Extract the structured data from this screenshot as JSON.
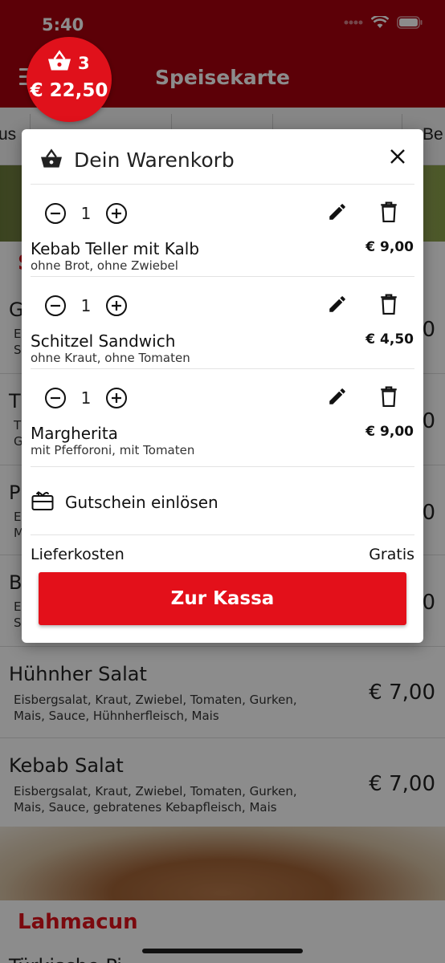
{
  "status_bar": {
    "time": "5:40"
  },
  "nav": {
    "title": "Speisekarte"
  },
  "categories": [
    "us",
    "Be"
  ],
  "cart_badge": {
    "count": "3",
    "total": "€ 22,50"
  },
  "menu": {
    "section_letter": "S",
    "items": [
      {
        "name": "G",
        "desc": "Ei\nS",
        "price": "0"
      },
      {
        "name": "T",
        "desc": "T\nG",
        "price": "0"
      },
      {
        "name": "P",
        "desc": "Ei\nM",
        "price": "0"
      },
      {
        "name": "B",
        "desc": "Ei\nS",
        "price": "0"
      },
      {
        "name": "Hühnher Salat",
        "desc": "Eisbergsalat, Kraut, Zwiebel, Tomaten, Gurken, Mais, Sauce, Hühnherfleisch, Mais",
        "price": "€ 7,00"
      },
      {
        "name": "Kebab Salat",
        "desc": "Eisbergsalat, Kraut, Zwiebel, Tomaten, Gurken, Mais, Sauce, gebratenes Kebapfleisch, Mais",
        "price": "€ 7,00"
      }
    ],
    "section2_title": "Lahmacun",
    "section2_next": "Türkische Pi"
  },
  "cart": {
    "title": "Dein Warenkorb",
    "items": [
      {
        "qty": "1",
        "name": "Kebab Teller mit Kalb",
        "options": "ohne Brot, ohne Zwiebel",
        "price": "€ 9,00"
      },
      {
        "qty": "1",
        "name": "Schitzel Sandwich",
        "options": "ohne Kraut, ohne Tomaten",
        "price": "€ 4,50"
      },
      {
        "qty": "1",
        "name": "Margherita",
        "options": "mit Pfefforoni, mit Tomaten",
        "price": "€ 9,00"
      }
    ],
    "voucher_label": "Gutschein einlösen",
    "delivery_label": "Lieferkosten",
    "delivery_value": "Gratis",
    "checkout_label": "Zur Kassa"
  },
  "colors": {
    "brand": "#a8000e",
    "accent": "#e0111b"
  }
}
